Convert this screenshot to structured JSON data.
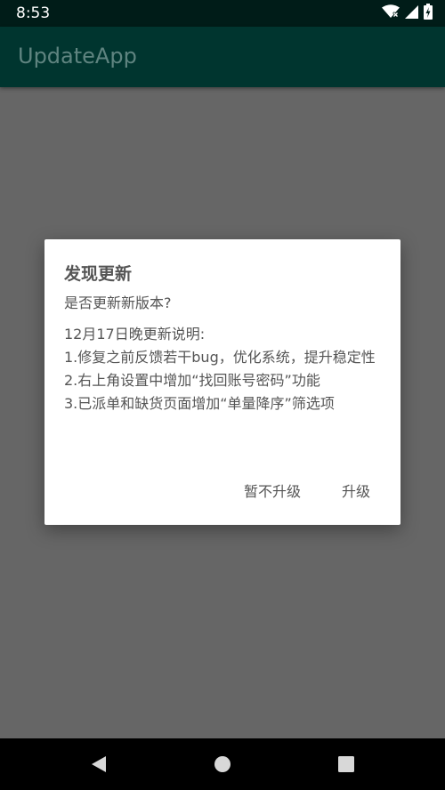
{
  "status_bar": {
    "time": "8:53",
    "icons": [
      "wifi-icon",
      "signal-icon",
      "battery-charging-icon"
    ]
  },
  "app_bar": {
    "title": "UpdateApp"
  },
  "dialog": {
    "title": "发现更新",
    "question": "是否更新新版本?",
    "notes": [
      "12月17日晚更新说明:",
      "1.修复之前反馈若干bug，优化系统，提升稳定性",
      "2.右上角设置中增加“找回账号密码”功能",
      "3.已派单和缺货页面增加“单量降序”筛选项"
    ],
    "negative_button": "暂不升级",
    "positive_button": "升级"
  },
  "nav_bar": {
    "icons": [
      "back-icon",
      "home-icon",
      "recents-icon"
    ]
  },
  "colors": {
    "status_bar": "#001c18",
    "app_bar": "#00352f",
    "app_title": "#5f8480",
    "scrim_background": "#666666",
    "dialog_text": "#555555"
  }
}
